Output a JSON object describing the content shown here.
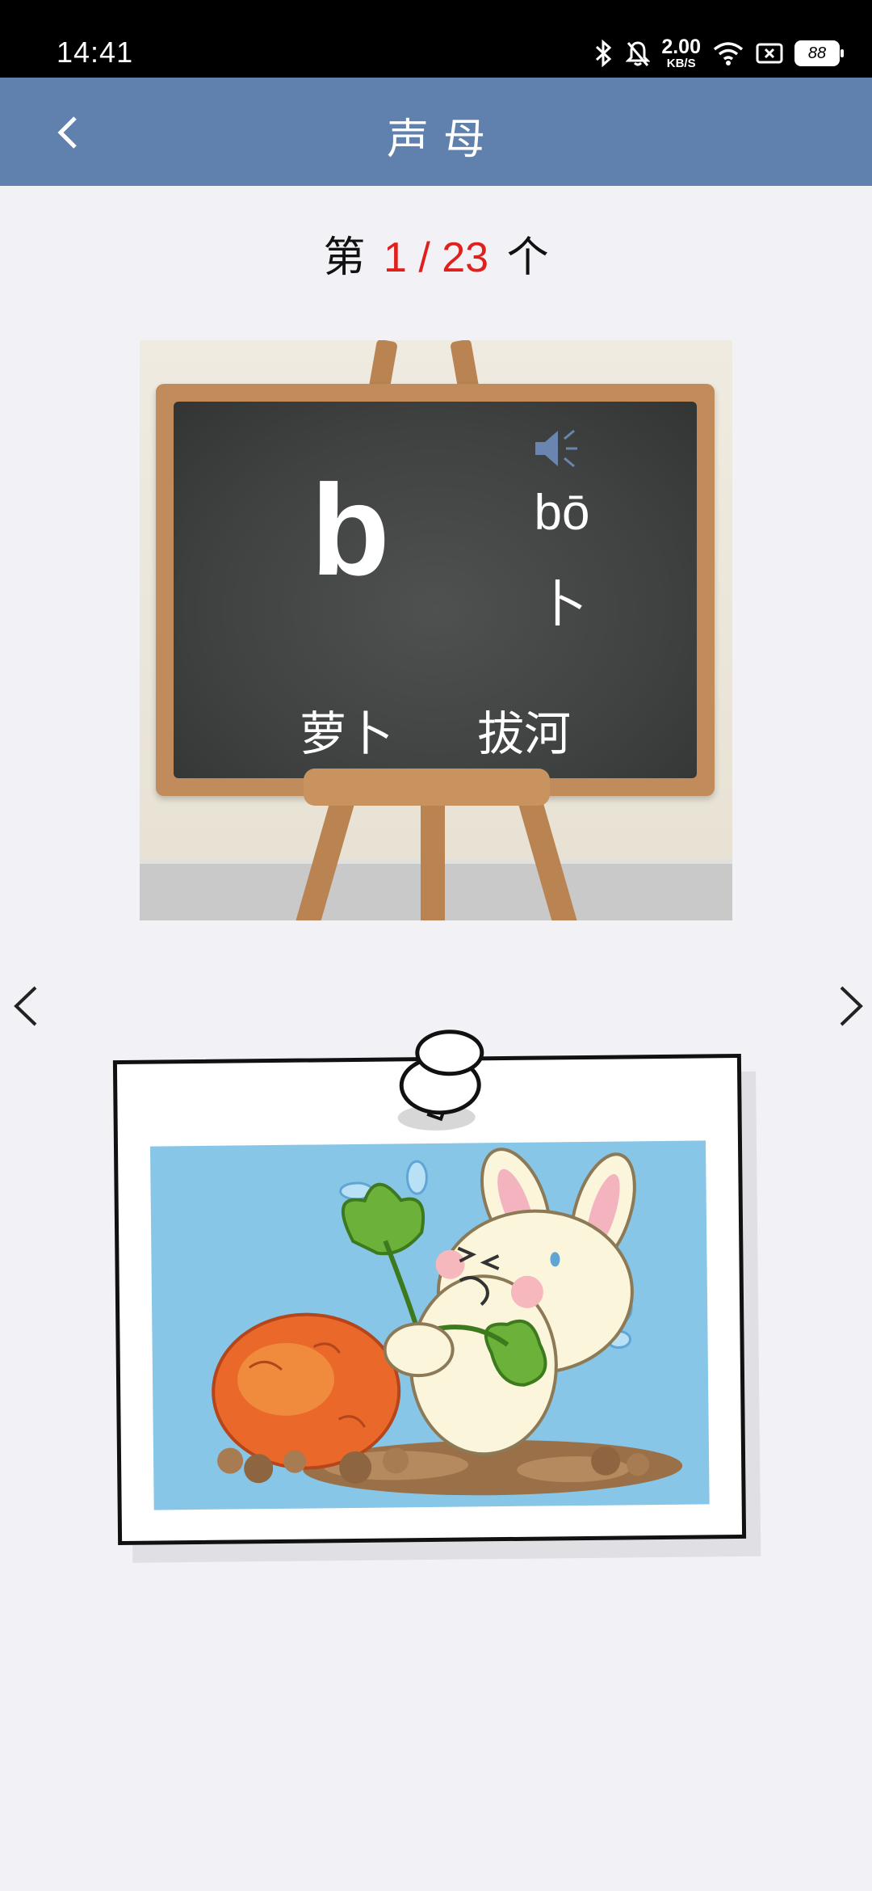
{
  "status_bar": {
    "time": "14:41",
    "net_speed_value": "2.00",
    "net_speed_unit": "KB/S",
    "battery": "88",
    "icons": [
      "bluetooth-icon",
      "mute-bell-icon",
      "wifi-icon",
      "sim-icon",
      "battery-icon"
    ]
  },
  "app_bar": {
    "title": "声母",
    "back_icon": "chevron-left-icon",
    "color": "#6081ad"
  },
  "counter": {
    "prefix": "第",
    "current": "1",
    "separator": "/",
    "total": "23",
    "suffix": "个",
    "highlight_color": "#e0201c"
  },
  "card": {
    "letter": "b",
    "sound_icon": "speaker-icon",
    "pinyin": "bō",
    "hanzi": "卜",
    "words": [
      "萝卜",
      "拔河"
    ]
  },
  "navigation": {
    "prev_icon": "chevron-left-icon",
    "next_icon": "chevron-right-icon"
  },
  "illustration": {
    "description_icon": "rabbit-pulling-radish-illustration"
  }
}
